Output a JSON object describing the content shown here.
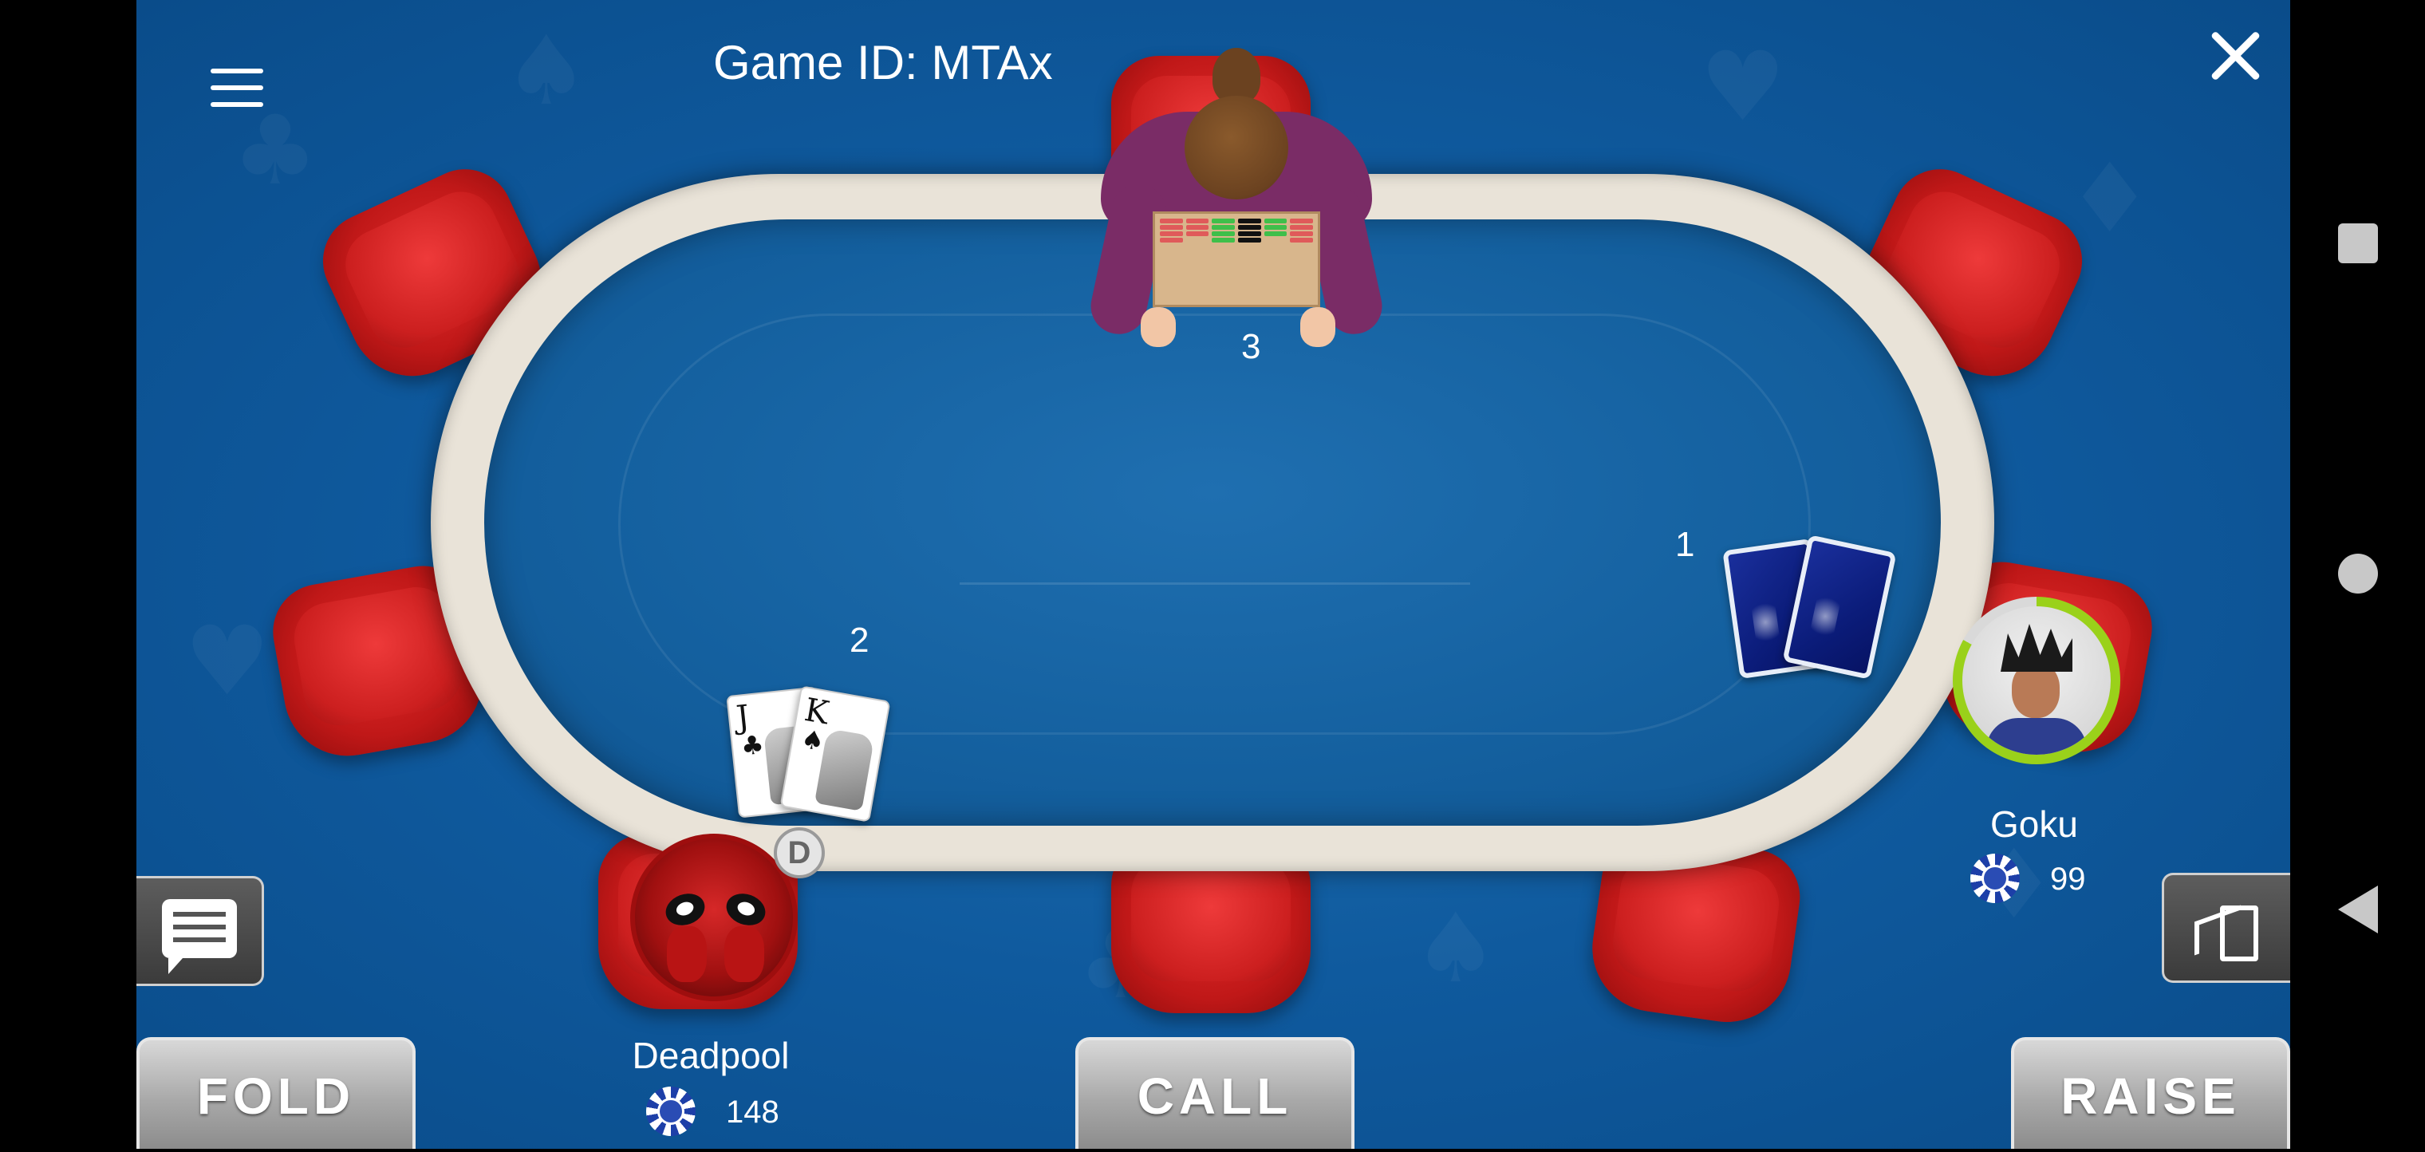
{
  "header": {
    "game_id": "Game ID: MTAx"
  },
  "seats": {
    "dealer_seat_number": "3",
    "seat_one_number": "1",
    "seat_two_number": "2"
  },
  "cards": {
    "player_two": [
      {
        "rank": "J",
        "suit": "♣"
      },
      {
        "rank": "K",
        "suit": "♠"
      }
    ]
  },
  "players": {
    "deadpool": {
      "name": "Deadpool",
      "chips": "148"
    },
    "goku": {
      "name": "Goku",
      "chips": "99",
      "timer_progress": 0.83
    }
  },
  "dealer_button": "D",
  "actions": {
    "fold": "FOLD",
    "call": "CALL",
    "raise": "RAISE"
  },
  "colors": {
    "felt": "#1565a8",
    "rail": "#e9e3d8",
    "chair": "#d02020",
    "timer": "#9ad11a"
  },
  "icons": [
    "menu-icon",
    "close-icon",
    "chat-icon",
    "exit-icon",
    "chip-icon"
  ]
}
